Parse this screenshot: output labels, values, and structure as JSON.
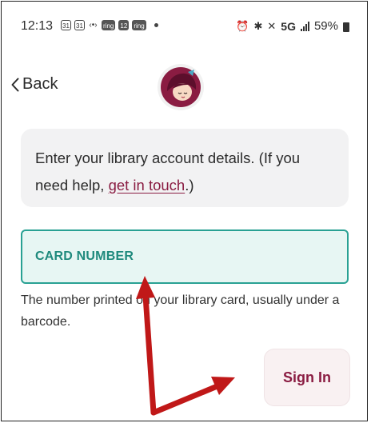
{
  "status_bar": {
    "time": "12:13",
    "left_icons": [
      "31",
      "31",
      "‹•›",
      "ring",
      "12",
      "ring"
    ],
    "network": "5G",
    "battery": "59%"
  },
  "nav": {
    "back_label": "Back"
  },
  "info": {
    "text_before": "Enter your library account details. (If you need help, ",
    "link": "get in touch",
    "text_after": ".)"
  },
  "form": {
    "card_number_label": "CARD NUMBER",
    "card_number_hint": "The number printed on your library card, usually under a barcode."
  },
  "actions": {
    "sign_in_label": "Sign In"
  },
  "colors": {
    "brand": "#8a1c42",
    "field_accent": "#29a193",
    "annotation_arrow": "#c01818"
  }
}
